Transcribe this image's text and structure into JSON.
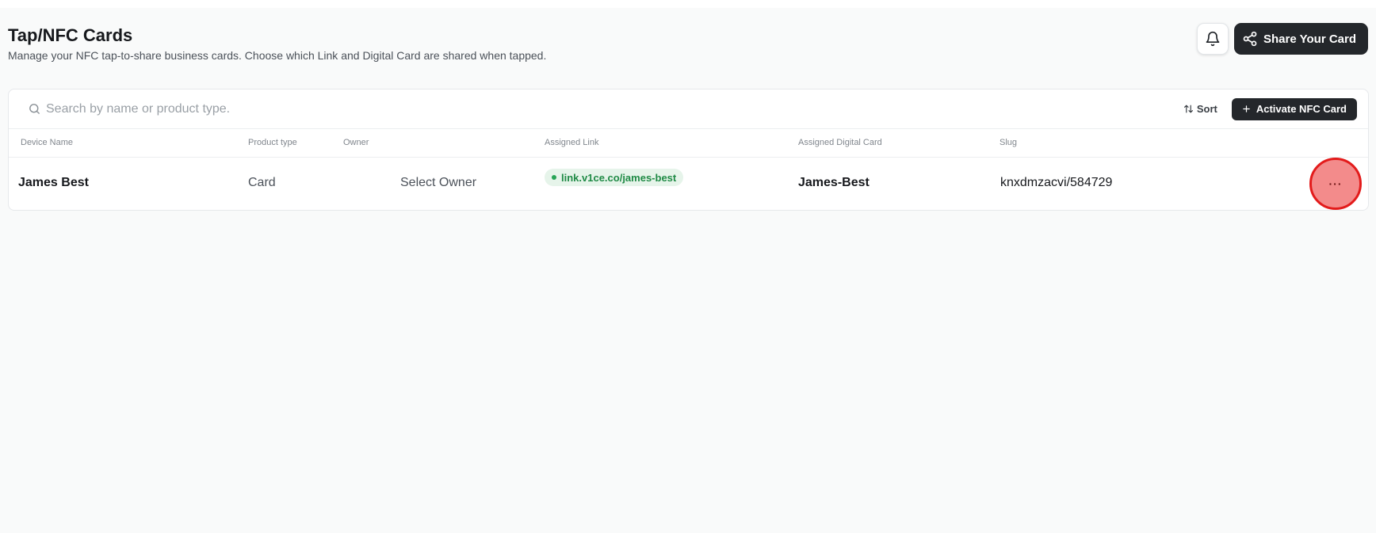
{
  "header": {
    "title": "Tap/NFC Cards",
    "subtitle": "Manage your NFC tap-to-share business cards. Choose which Link and Digital Card are shared when tapped.",
    "share_label": "Share Your Card"
  },
  "toolbar": {
    "search_placeholder": "Search by name or product type.",
    "sort_label": "Sort",
    "activate_label": "Activate NFC Card"
  },
  "table": {
    "columns": [
      "Device Name",
      "Product type",
      "Owner",
      "Assigned Link",
      "Assigned Digital Card",
      "Slug"
    ],
    "rows": [
      {
        "device_name": "James Best",
        "product_type": "Card",
        "owner": "Select Owner",
        "assigned_link": "link.v1ce.co/james-best",
        "assigned_digital_card": "James-Best",
        "slug": "knxdmzacvi/584729",
        "more": "···"
      }
    ]
  },
  "icons": {
    "bell": "bell-icon",
    "share": "share-icon",
    "search": "search-icon",
    "sort": "sort-icon",
    "plus": "plus-icon"
  },
  "colors": {
    "primary_dark": "#24272b",
    "link_green": "#1f8a45",
    "highlight_red": "#e31b1b"
  }
}
